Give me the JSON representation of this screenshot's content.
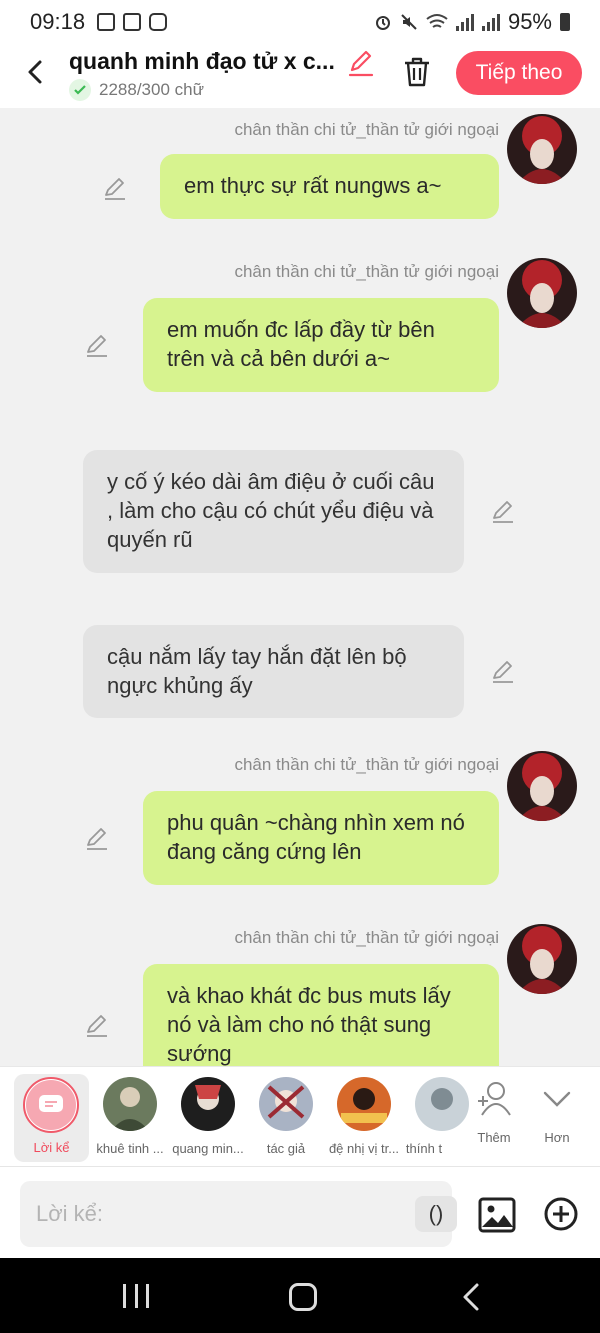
{
  "status": {
    "time": "09:18",
    "battery": "95%"
  },
  "header": {
    "title": "quanh minh đạo tử x c...",
    "word_count": "2288/300 chữ",
    "next_label": "Tiếp theo"
  },
  "messages": [
    {
      "sender": "chân thần chi tử_thần tử giới ngoại",
      "text": "em thực sự rất nungws a~",
      "side": "right"
    },
    {
      "sender": "chân thần chi tử_thần tử giới ngoại",
      "text": "em muốn đc lấp đầy từ bên trên và cả bên dưới a~",
      "side": "right"
    },
    {
      "text": "y cố ý kéo dài âm điệu ở cuối câu , làm cho cậu có chút yểu điệu và quyến rũ",
      "side": "narration"
    },
    {
      "text": "cậu nắm lấy tay hắn đặt lên bộ ngực khủng ấy",
      "side": "narration"
    },
    {
      "sender": "chân thần chi tử_thần tử giới ngoại",
      "text": "phu quân ~chàng nhìn xem nó đang căng cứng lên",
      "side": "right"
    },
    {
      "sender": "chân thần chi tử_thần tử giới ngoại",
      "text": "và khao khát đc bus muts lấy nó và làm cho nó thật sung sướng",
      "side": "right"
    }
  ],
  "characters": {
    "narration_label": "Lời kể",
    "items": [
      {
        "label": "khuê tinh ..."
      },
      {
        "label": "quang min..."
      },
      {
        "label": "tác giả"
      },
      {
        "label": "đệ nhị vị tr..."
      },
      {
        "label": "thính t"
      }
    ],
    "more_label": "Thêm",
    "expand_label": "Hơn"
  },
  "input": {
    "placeholder": "Lời kể:",
    "paren_label": "()"
  },
  "colors": {
    "accent": "#fa4d62",
    "user_bubble": "#d7f38f",
    "narration_bubble": "#e3e3e3"
  }
}
